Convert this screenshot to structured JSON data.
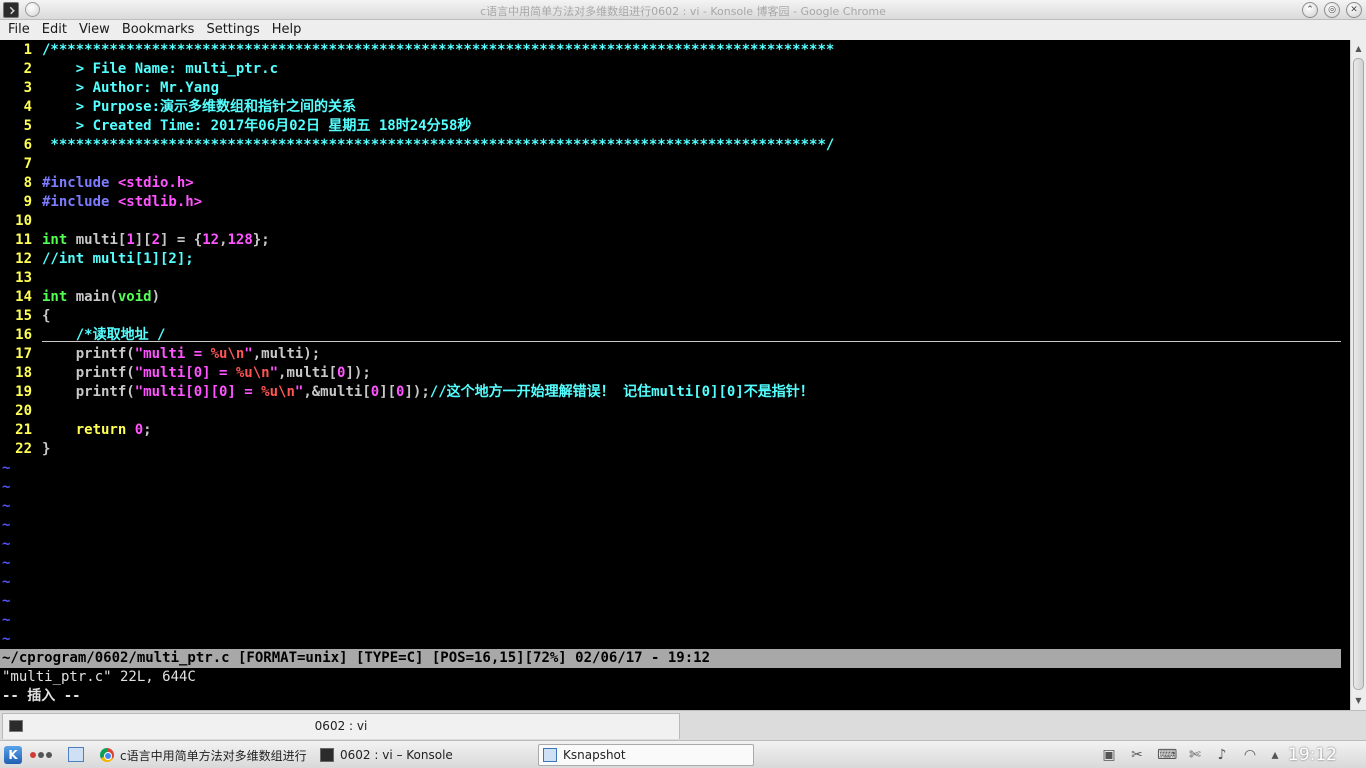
{
  "window": {
    "title": "c语言中用简单方法对多维数组进行0602 : vi - Konsole 博客园 - Google Chrome",
    "controls": {
      "minimize": "⌃",
      "maximize": "◎",
      "close": "✕"
    }
  },
  "menubar": [
    "File",
    "Edit",
    "View",
    "Bookmarks",
    "Settings",
    "Help"
  ],
  "editor": {
    "lines": [
      {
        "n": "1",
        "parts": [
          {
            "t": "/*********************************************************************************************",
            "c": "comment"
          }
        ]
      },
      {
        "n": "2",
        "parts": [
          {
            "t": "    > File Name: multi_ptr.c",
            "c": "comment"
          }
        ]
      },
      {
        "n": "3",
        "parts": [
          {
            "t": "    > Author: Mr.Yang",
            "c": "comment"
          }
        ]
      },
      {
        "n": "4",
        "parts": [
          {
            "t": "    > Purpose:演示多维数组和指针之间的关系",
            "c": "comment"
          }
        ]
      },
      {
        "n": "5",
        "parts": [
          {
            "t": "    > Created Time: 2017年06月02日 星期五 18时24分58秒",
            "c": "comment"
          }
        ]
      },
      {
        "n": "6",
        "parts": [
          {
            "t": " ********************************************************************************************/",
            "c": "comment"
          }
        ]
      },
      {
        "n": "7",
        "parts": []
      },
      {
        "n": "8",
        "parts": [
          {
            "t": "#include ",
            "c": "pre"
          },
          {
            "t": "<stdio.h>",
            "c": "str"
          }
        ]
      },
      {
        "n": "9",
        "parts": [
          {
            "t": "#include ",
            "c": "pre"
          },
          {
            "t": "<stdlib.h>",
            "c": "str"
          }
        ]
      },
      {
        "n": "10",
        "parts": []
      },
      {
        "n": "11",
        "parts": [
          {
            "t": "int",
            "c": "type"
          },
          {
            "t": " multi[",
            "c": "plain"
          },
          {
            "t": "1",
            "c": "str"
          },
          {
            "t": "][",
            "c": "plain"
          },
          {
            "t": "2",
            "c": "str"
          },
          {
            "t": "] = {",
            "c": "plain"
          },
          {
            "t": "12",
            "c": "str"
          },
          {
            "t": ",",
            "c": "plain"
          },
          {
            "t": "128",
            "c": "str"
          },
          {
            "t": "};",
            "c": "plain"
          }
        ]
      },
      {
        "n": "12",
        "parts": [
          {
            "t": "//int multi[1][2];",
            "c": "comment"
          }
        ]
      },
      {
        "n": "13",
        "parts": []
      },
      {
        "n": "14",
        "parts": [
          {
            "t": "int",
            "c": "type"
          },
          {
            "t": " main(",
            "c": "plain"
          },
          {
            "t": "void",
            "c": "type"
          },
          {
            "t": ")",
            "c": "plain"
          }
        ]
      },
      {
        "n": "15",
        "parts": [
          {
            "t": "{",
            "c": "plain"
          }
        ]
      },
      {
        "n": "16",
        "parts": [
          {
            "t": "    /*读取地址",
            "c": "comment"
          },
          {
            "t": "*",
            "c": "cursor"
          },
          {
            "t": "/",
            "c": "comment"
          }
        ]
      },
      {
        "n": "17",
        "parts": [
          {
            "t": "    printf(",
            "c": "plain"
          },
          {
            "t": "\"multi = ",
            "c": "str"
          },
          {
            "t": "%u\\n",
            "c": "fmt"
          },
          {
            "t": "\"",
            "c": "str"
          },
          {
            "t": ",multi);",
            "c": "plain"
          }
        ]
      },
      {
        "n": "18",
        "parts": [
          {
            "t": "    printf(",
            "c": "plain"
          },
          {
            "t": "\"multi[0] = ",
            "c": "str"
          },
          {
            "t": "%u\\n",
            "c": "fmt"
          },
          {
            "t": "\"",
            "c": "str"
          },
          {
            "t": ",multi[",
            "c": "plain"
          },
          {
            "t": "0",
            "c": "str"
          },
          {
            "t": "]);",
            "c": "plain"
          }
        ]
      },
      {
        "n": "19",
        "parts": [
          {
            "t": "    printf(",
            "c": "plain"
          },
          {
            "t": "\"multi[0][0] = ",
            "c": "str"
          },
          {
            "t": "%u\\n",
            "c": "fmt"
          },
          {
            "t": "\"",
            "c": "str"
          },
          {
            "t": ",&multi[",
            "c": "plain"
          },
          {
            "t": "0",
            "c": "str"
          },
          {
            "t": "][",
            "c": "plain"
          },
          {
            "t": "0",
            "c": "str"
          },
          {
            "t": "]);",
            "c": "plain"
          },
          {
            "t": "//这个地方一开始理解错误！ 记住multi[0][0]不是指针！",
            "c": "comment"
          }
        ]
      },
      {
        "n": "20",
        "parts": []
      },
      {
        "n": "21",
        "parts": [
          {
            "t": "    ",
            "c": "plain"
          },
          {
            "t": "return",
            "c": "keyword"
          },
          {
            "t": " ",
            "c": "plain"
          },
          {
            "t": "0",
            "c": "str"
          },
          {
            "t": ";",
            "c": "plain"
          }
        ]
      },
      {
        "n": "22",
        "parts": [
          {
            "t": "}",
            "c": "plain"
          }
        ]
      }
    ],
    "tilde": "~",
    "tilde_count": 10,
    "status_line": "~/cprogram/0602/multi_ptr.c [FORMAT=unix] [TYPE=C] [POS=16,15][72%] 02/06/17 - 19:12",
    "file_message": "\"multi_ptr.c\" 22L, 644C",
    "mode_message": "-- 插入 --"
  },
  "konsole_tab": {
    "label": "0602 : vi"
  },
  "taskbar": {
    "tasks": [
      {
        "label": "c语言中用简单方法对多维数组进行",
        "icon": "chrome-icon",
        "active": false
      },
      {
        "label": "0602 : vi – Konsole",
        "icon": "konsole-icon",
        "active": false
      },
      {
        "label": "Ksnapshot",
        "icon": "ksnapshot-icon",
        "active": true
      }
    ],
    "clock": "19:12",
    "tray_icons": [
      "terminal-icon",
      "tools-icon",
      "keyboard-icon",
      "scissors-icon",
      "volume-icon",
      "wifi-icon",
      "chevron-up-icon"
    ]
  },
  "colors": {
    "comment": "#54ffff",
    "string": "#ff54ff",
    "type": "#54ff54",
    "line_number": "#ffff54",
    "preprocessor": "#7c7cff",
    "tilde": "#5454ff"
  }
}
